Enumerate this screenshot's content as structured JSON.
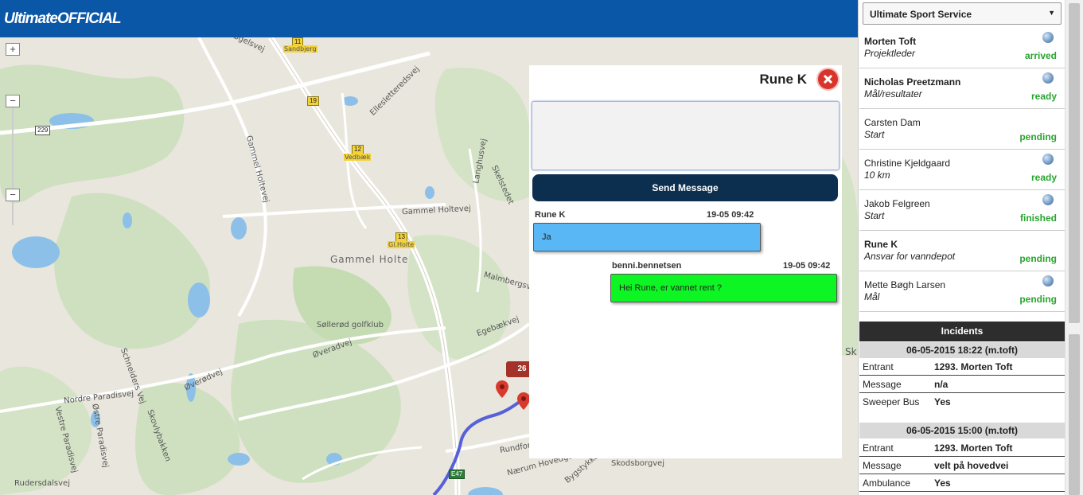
{
  "header": {
    "logo_text": "UltimateOFFICIAL",
    "bg_color": "#0a57a8"
  },
  "map": {
    "labels": {
      "gammel_holte_big": "Gammel Holte",
      "gammel_holtevej": "Gammel Holtevej",
      "sollerod_golfklub": "Søllerød golfklub",
      "nordre_paradisvej": "Nordre Paradisvej",
      "overodvej": "Øverødvej",
      "overadvej": "Øveradvej",
      "malmbergsvej": "Malmbergsvej",
      "egebaekvej": "Egebækvej",
      "skelstedet": "Skelstedet",
      "langhusvej": "Langhusvej",
      "ellesletteredsvej": "Ellesletteredsvej",
      "gammel_holtevej_v": "Gammel Holtevej",
      "goegelsvej": "Gøgelsvej",
      "rundforbi": "Rundforbi",
      "nearum_hovedgade": "Nærum Hovedgade",
      "skodsborgvej": "Skodsborgvej",
      "rudersdalsvej": "Rudersdalsvej",
      "vestre_paradisvej": "Vestre Paradisvej",
      "ostre_paradisvej": "Østre Paradisvej",
      "skovlybakken": "Skovlybakken",
      "schneiders_vej": "Schneiders Vej",
      "bygstykket": "Bygstykket",
      "vedbaek": "Vedbæk",
      "sandbjerg": "Sandbjerg",
      "gl_holte": "Gl.Holte",
      "sk": "Sk"
    },
    "shields": {
      "s229": "229",
      "s11": "11",
      "s19": "19",
      "s12": "12",
      "s13": "13",
      "e47": "E47"
    },
    "zoom": {
      "in": "+",
      "out": "−",
      "out2": "−"
    },
    "route_badge": "26"
  },
  "chat": {
    "title": "Rune K",
    "input_value": "",
    "send_label": "Send Message",
    "messages": [
      {
        "from": "Rune K",
        "time": "19-05 09:42",
        "text": "Ja"
      },
      {
        "from": "benni.bennetsen",
        "time": "19-05 09:42",
        "text": "Hei Rune, er vannet rent ?"
      }
    ]
  },
  "sidebar": {
    "service": "Ultimate Sport Service",
    "people": [
      {
        "name": "Morten Toft",
        "role": "Projektleder",
        "status": "arrived",
        "bold": true,
        "globe": true
      },
      {
        "name": "Nicholas Preetzmann",
        "role": "Mål/resultater",
        "status": "ready",
        "bold": true,
        "globe": true
      },
      {
        "name": "Carsten Dam",
        "role": "Start",
        "status": "pending",
        "bold": false,
        "globe": false
      },
      {
        "name": "Christine Kjeldgaard",
        "role": "10 km",
        "status": "ready",
        "bold": false,
        "globe": true
      },
      {
        "name": "Jakob Felgreen",
        "role": "Start",
        "status": "finished",
        "bold": false,
        "globe": true
      },
      {
        "name": "Rune K",
        "role": "Ansvar for vanndepot",
        "status": "pending",
        "bold": true,
        "globe": false
      },
      {
        "name": "Mette Bøgh Larsen",
        "role": "Mål",
        "status": "pending",
        "bold": false,
        "globe": true
      }
    ],
    "incidents_title": "Incidents",
    "incidents": [
      {
        "date": "06-05-2015 18:22 (m.toft)",
        "rows": [
          {
            "key": "Entrant",
            "value": "1293. Morten Toft"
          },
          {
            "key": "Message",
            "value": "n/a"
          },
          {
            "key": "Sweeper Bus",
            "value": "Yes"
          }
        ]
      },
      {
        "date": "06-05-2015 15:00 (m.toft)",
        "rows": [
          {
            "key": "Entrant",
            "value": "1293. Morten Toft"
          },
          {
            "key": "Message",
            "value": "velt på hovedvei"
          },
          {
            "key": "Ambulance",
            "value": "Yes"
          }
        ]
      }
    ],
    "status_color": "#27a52e"
  }
}
